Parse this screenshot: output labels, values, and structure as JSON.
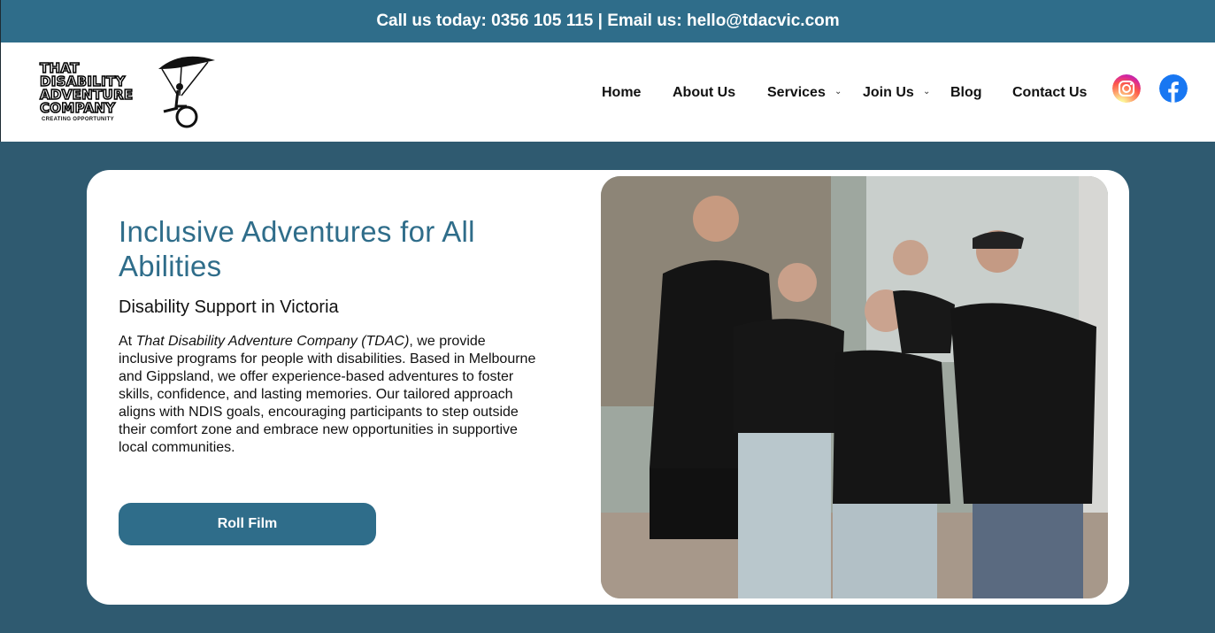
{
  "topbar": {
    "text": "Call us today: 0356 105 115 | Email us: hello@tdacvic.com"
  },
  "logo": {
    "lines": [
      "THAT",
      "DISABILITY",
      "ADVENTURE",
      "COMPANY"
    ],
    "tagline": "CREATING OPPORTUNITY"
  },
  "nav": {
    "items": [
      {
        "label": "Home"
      },
      {
        "label": "About Us"
      },
      {
        "label": "Services",
        "has_dropdown": true
      },
      {
        "label": "Join Us",
        "has_dropdown": true
      },
      {
        "label": "Blog"
      },
      {
        "label": "Contact Us"
      }
    ],
    "social": [
      {
        "icon": "instagram-icon"
      },
      {
        "icon": "facebook-icon",
        "color": "#1877f2"
      }
    ]
  },
  "hero": {
    "title": "Inclusive Adventures for All Abilities",
    "subtitle": "Disability Support in Victoria",
    "desc_prefix": "At ",
    "desc_company": "That Disability Adventure Company (TDAC)",
    "desc_body": ", we provide inclusive programs for people with disabilities. Based in Melbourne and Gippsland, we offer experience-based adventures to foster skills, confidence, and lasting memories. Our tailored approach aligns with NDIS goals, encouraging participants to step outside their comfort zone and embrace new opportunities in supportive local communities.",
    "cta_label": "Roll Film"
  },
  "colors": {
    "brand": "#2f6d8a",
    "background": "#2f5a70",
    "card": "#ffffff"
  }
}
